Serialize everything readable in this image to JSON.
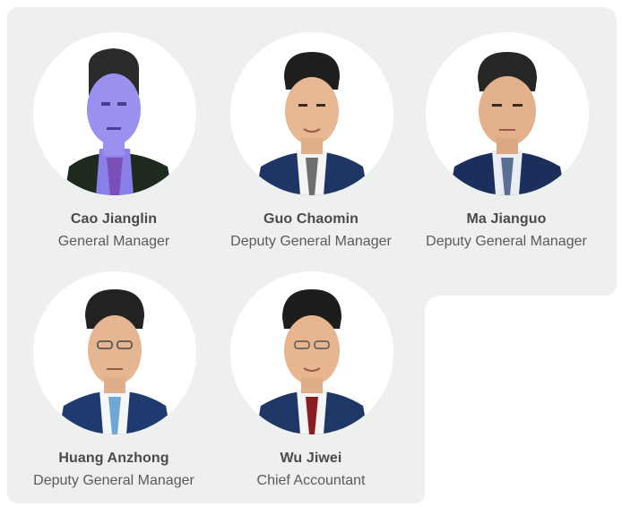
{
  "colors": {
    "panel_background": "#eef0f0",
    "panel_border": "#ffffff",
    "name_text": "#4a4a4a",
    "title_text": "#5a5a5a"
  },
  "members": [
    {
      "name": "Cao Jianglin",
      "title": "General Manager"
    },
    {
      "name": "Guo Chaomin",
      "title": "Deputy General Manager"
    },
    {
      "name": "Ma Jianguo",
      "title": "Deputy General Manager"
    },
    {
      "name": "Huang Anzhong",
      "title": "Deputy General Manager"
    },
    {
      "name": "Wu Jiwei",
      "title": "Chief Accountant"
    }
  ]
}
